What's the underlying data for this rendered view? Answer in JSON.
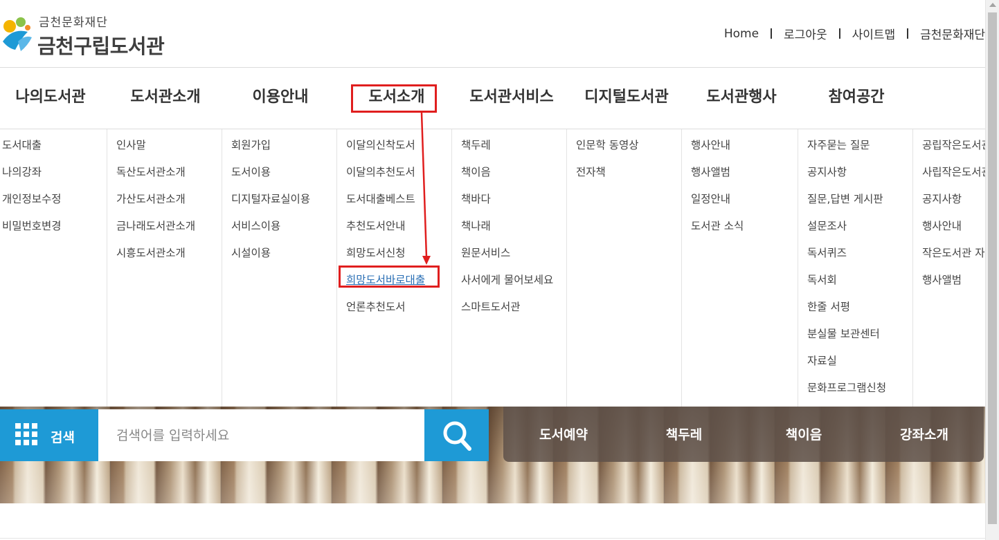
{
  "header": {
    "logo_sub": "금천문화재단",
    "logo_main": "금천구립도서관",
    "util_links": [
      "Home",
      "로그아웃",
      "사이트맵",
      "금천문화재단"
    ]
  },
  "gnb": {
    "items": [
      "나의도서관",
      "도서관소개",
      "이용안내",
      "도서소개",
      "도서관서비스",
      "디지털도서관",
      "도서관행사",
      "참여공간"
    ]
  },
  "mega": {
    "columns": [
      [
        "도서대출",
        "나의강좌",
        "개인정보수정",
        "비밀번호변경"
      ],
      [
        "인사말",
        "독산도서관소개",
        "가산도서관소개",
        "금나래도서관소개",
        "시흥도서관소개"
      ],
      [
        "회원가입",
        "도서이용",
        "디지털자료실이용",
        "서비스이용",
        "시설이용"
      ],
      [
        "이달의신착도서",
        "이달의추천도서",
        "도서대출베스트",
        "추천도서안내",
        "희망도서신청",
        "희망도서바로대출",
        "언론추천도서"
      ],
      [
        "책두레",
        "책이음",
        "책바다",
        "책나래",
        "원문서비스",
        "사서에게 물어보세요",
        "스마트도서관"
      ],
      [
        "인문학 동영상",
        "전자책"
      ],
      [
        "행사안내",
        "행사앨범",
        "일정안내",
        "도서관 소식"
      ],
      [
        "자주묻는 질문",
        "공지사항",
        "질문,답변 게시판",
        "설문조사",
        "독서퀴즈",
        "독서회",
        "한줄 서평",
        "분실물 보관센터",
        "자료실",
        "문화프로그램신청"
      ],
      [
        "공립작은도서관",
        "사립작은도서관",
        "공지사항",
        "행사안내",
        "작은도서관 자료",
        "행사앨범"
      ]
    ]
  },
  "search": {
    "label": "검색",
    "placeholder": "검색어를 입력하세요"
  },
  "quick_links": [
    "도서예약",
    "책두레",
    "책이음",
    "강좌소개"
  ],
  "colors": {
    "accent_blue": "#1e9ad6",
    "annotation_red": "#e01e1e",
    "active_link": "#2a6fb5"
  }
}
